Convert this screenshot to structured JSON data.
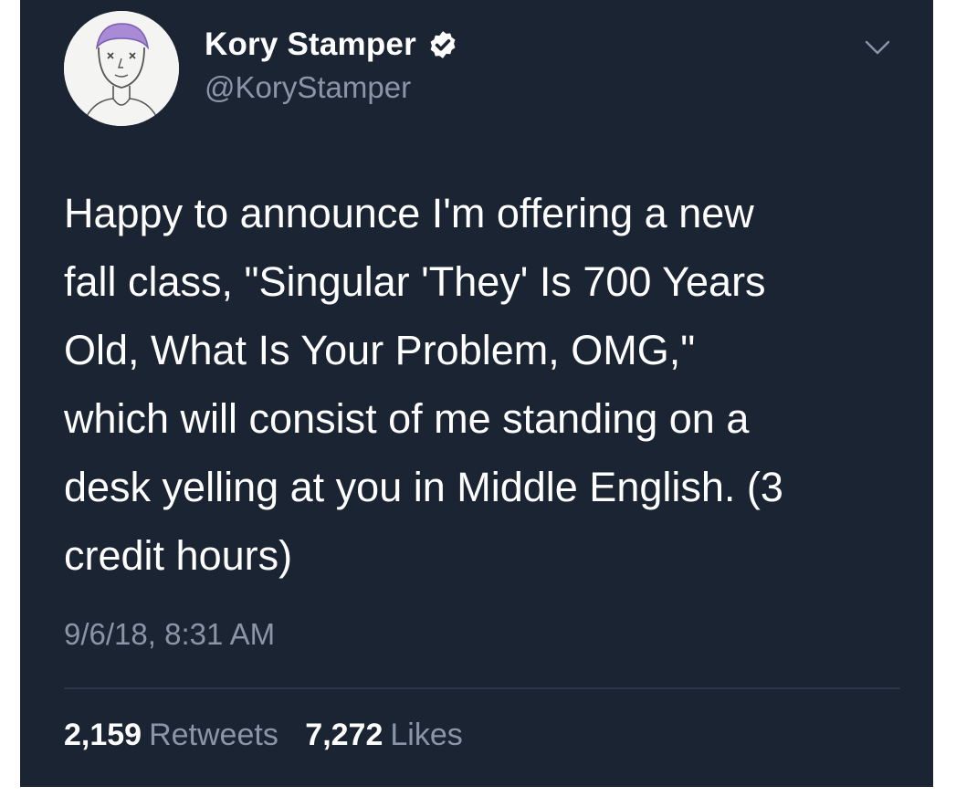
{
  "tweet": {
    "author": {
      "display_name": "Kory Stamper",
      "handle": "@KoryStamper",
      "verified": true,
      "avatar": "illustrated-portrait-avatar"
    },
    "text_lines": [
      "Happy to announce I'm offering a new",
      "fall class, \"Singular 'They' Is 700 Years",
      "Old, What Is Your Problem, OMG,\"",
      "which will consist of me standing on a",
      "desk yelling at you in Middle English. (3",
      "credit hours)"
    ],
    "timestamp": "9/6/18, 8:31 AM",
    "stats": {
      "retweets_count": "2,159",
      "retweets_label": "Retweets",
      "likes_count": "7,272",
      "likes_label": "Likes"
    }
  },
  "colors": {
    "background": "#1b2433",
    "text_primary": "#ffffff",
    "text_secondary": "#8a96a5",
    "divider": "#2c3747",
    "avatar_hair": "#a88ad6"
  },
  "icons": {
    "verified": "verified-badge-icon",
    "menu": "chevron-down-icon"
  }
}
